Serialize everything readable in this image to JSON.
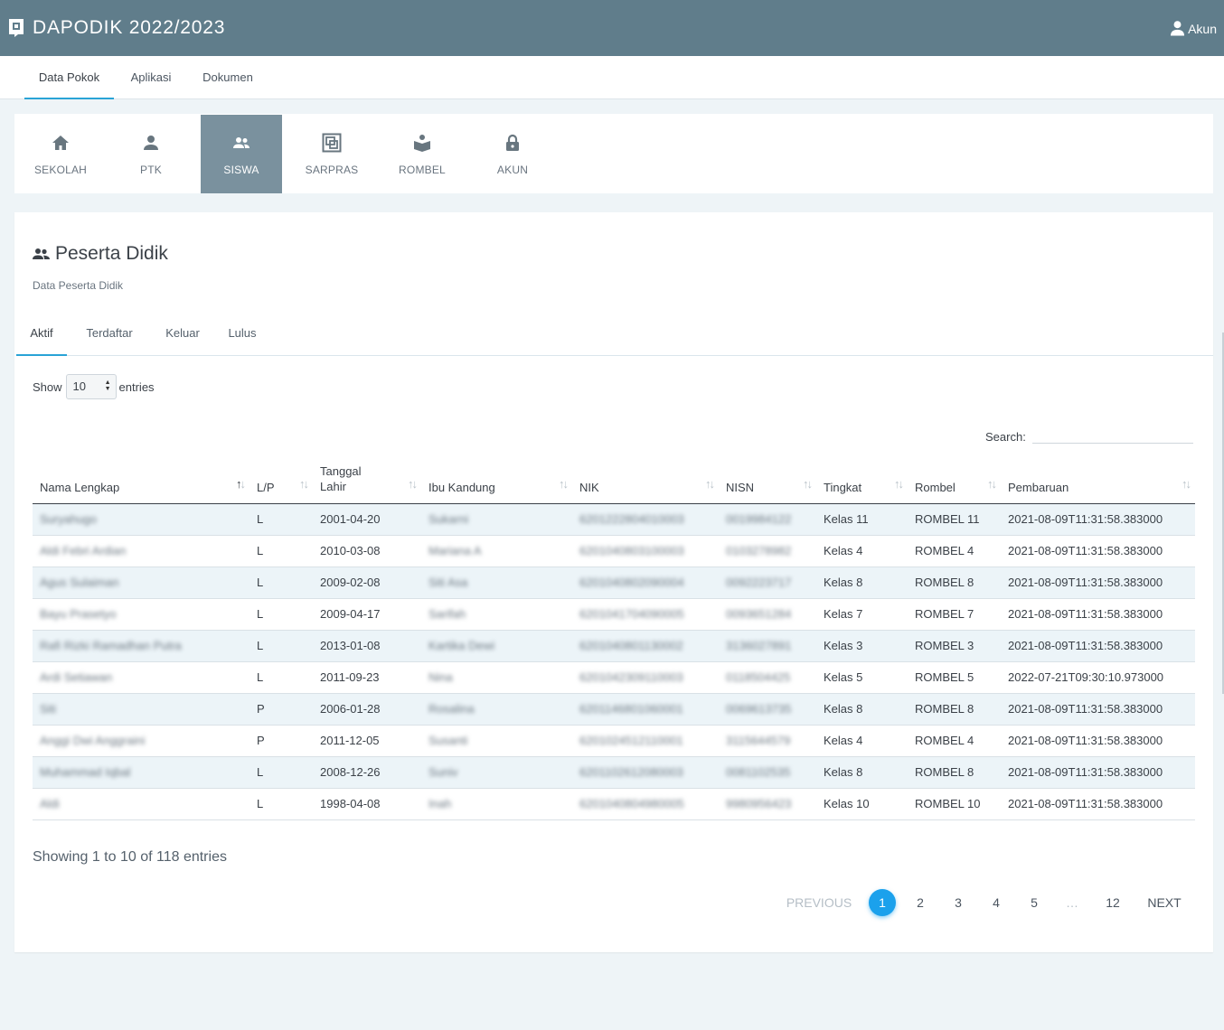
{
  "app": {
    "title": "DAPODIK 2022/2023",
    "account_label": "Akun"
  },
  "main_tabs": [
    {
      "label": "Data Pokok"
    },
    {
      "label": "Aplikasi"
    },
    {
      "label": "Dokumen"
    }
  ],
  "modules": [
    {
      "label": "SEKOLAH",
      "icon": "home-icon"
    },
    {
      "label": "PTK",
      "icon": "person-icon"
    },
    {
      "label": "SISWA",
      "icon": "people-icon"
    },
    {
      "label": "SARPRAS",
      "icon": "building-icon"
    },
    {
      "label": "ROMBEL",
      "icon": "reader-icon"
    },
    {
      "label": "AKUN",
      "icon": "lock-icon"
    }
  ],
  "page": {
    "title": "Peserta Didik",
    "subtitle": "Data Peserta Didik"
  },
  "sub_tabs": [
    {
      "label": "Aktif"
    },
    {
      "label": "Terdaftar"
    },
    {
      "label": "Keluar"
    },
    {
      "label": "Lulus"
    }
  ],
  "length": {
    "show_label": "Show",
    "value": "10",
    "entries_label": "entries"
  },
  "search": {
    "label": "Search:",
    "value": ""
  },
  "table": {
    "columns": [
      "Nama Lengkap",
      "L/P",
      "Tanggal Lahir",
      "Ibu Kandung",
      "NIK",
      "NISN",
      "Tingkat",
      "Rombel",
      "Pembaruan"
    ],
    "rows": [
      [
        "Suryahugo",
        "L",
        "2001-04-20",
        "Sukarni",
        "6201222804010003",
        "0019984122",
        "Kelas 11",
        "ROMBEL 11",
        "2021-08-09T11:31:58.383000"
      ],
      [
        "Aldi Febri Ardian",
        "L",
        "2010-03-08",
        "Mariana A",
        "6201040803100003",
        "0103278982",
        "Kelas 4",
        "ROMBEL 4",
        "2021-08-09T11:31:58.383000"
      ],
      [
        "Agus Sulaiman",
        "L",
        "2009-02-08",
        "Siti Asa",
        "6201040802090004",
        "0092223717",
        "Kelas 8",
        "ROMBEL 8",
        "2021-08-09T11:31:58.383000"
      ],
      [
        "Bayu Prasetyo",
        "L",
        "2009-04-17",
        "Sarifah",
        "6201041704090005",
        "0093651284",
        "Kelas 7",
        "ROMBEL 7",
        "2021-08-09T11:31:58.383000"
      ],
      [
        "Rafi Rizki Ramadhan Putra",
        "L",
        "2013-01-08",
        "Kartika Dewi",
        "6201040801130002",
        "3136027891",
        "Kelas 3",
        "ROMBEL 3",
        "2021-08-09T11:31:58.383000"
      ],
      [
        "Ardi Setiawan",
        "L",
        "2011-09-23",
        "Nina",
        "6201042309110003",
        "0118504425",
        "Kelas 5",
        "ROMBEL 5",
        "2022-07-21T09:30:10.973000"
      ],
      [
        "Siti",
        "P",
        "2006-01-28",
        "Rosalina",
        "6201146801060001",
        "0069613735",
        "Kelas 8",
        "ROMBEL 8",
        "2021-08-09T11:31:58.383000"
      ],
      [
        "Anggi Dwi Anggraini",
        "P",
        "2011-12-05",
        "Susanti",
        "6201024512110001",
        "3115644579",
        "Kelas 4",
        "ROMBEL 4",
        "2021-08-09T11:31:58.383000"
      ],
      [
        "Muhammad Iqbal",
        "L",
        "2008-12-26",
        "Suniv",
        "6201102612080003",
        "0081102535",
        "Kelas 8",
        "ROMBEL 8",
        "2021-08-09T11:31:58.383000"
      ],
      [
        "Aldi",
        "L",
        "1998-04-08",
        "Inah",
        "6201040804980005",
        "9980956423",
        "Kelas 10",
        "ROMBEL 10",
        "2021-08-09T11:31:58.383000"
      ]
    ]
  },
  "info": "Showing 1 to 10 of 118 entries",
  "pagination": {
    "previous": "PREVIOUS",
    "pages": [
      "1",
      "2",
      "3",
      "4",
      "5",
      "…",
      "12"
    ],
    "active": "1",
    "next": "NEXT"
  },
  "colors": {
    "header": "#607d8b",
    "module_active": "#7a919e",
    "accent": "#1ba1ec",
    "tab_underline": "#29a3d6"
  }
}
